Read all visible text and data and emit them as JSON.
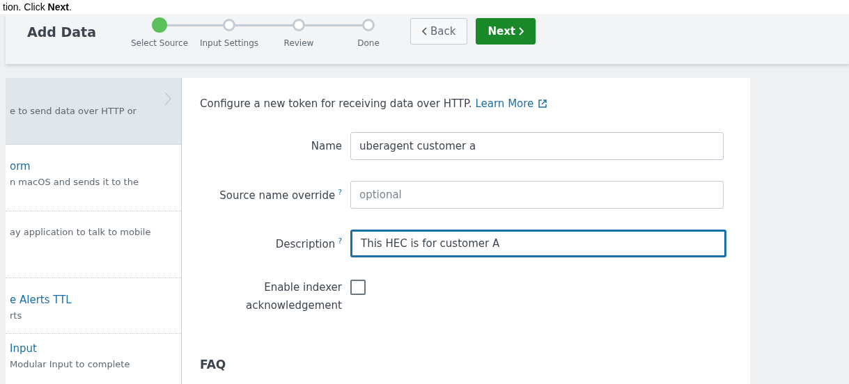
{
  "instruction": "tion. Click **Next**.",
  "header": {
    "title": "Add Data",
    "steps": [
      {
        "label": "Select Source",
        "selected": true
      },
      {
        "label": "Input Settings",
        "selected": false
      },
      {
        "label": "Review",
        "selected": false
      },
      {
        "label": "Done",
        "selected": false
      }
    ],
    "back_button": "Back",
    "next_button": "Next"
  },
  "source_list": [
    {
      "description": "e to send data over HTTP or",
      "selected": true
    },
    {
      "title": "orm",
      "description": "n macOS and sends it to the",
      "selected": false
    },
    {
      "description": "ay application to talk to mobile",
      "selected": false
    },
    {
      "title": "e Alerts TTL",
      "description": "rts",
      "selected": false
    },
    {
      "title": "Input",
      "description": "Modular Input to complete",
      "selected": false
    }
  ],
  "form": {
    "intro": "Configure a new token for receiving data over HTTP.",
    "learn_more": "Learn More",
    "fields": [
      {
        "label": "Name",
        "value": "uberagent customer a",
        "help": false,
        "focused": false
      },
      {
        "label": "Source name override",
        "placeholder": "optional",
        "help": true,
        "focused": false
      },
      {
        "label": "Description",
        "value": "This HEC is for customer A",
        "help": true,
        "focused": true
      }
    ],
    "help_mark": "?",
    "checkbox": {
      "label": "Enable indexer acknowledgement",
      "checked": false
    },
    "faq_heading": "FAQ"
  }
}
